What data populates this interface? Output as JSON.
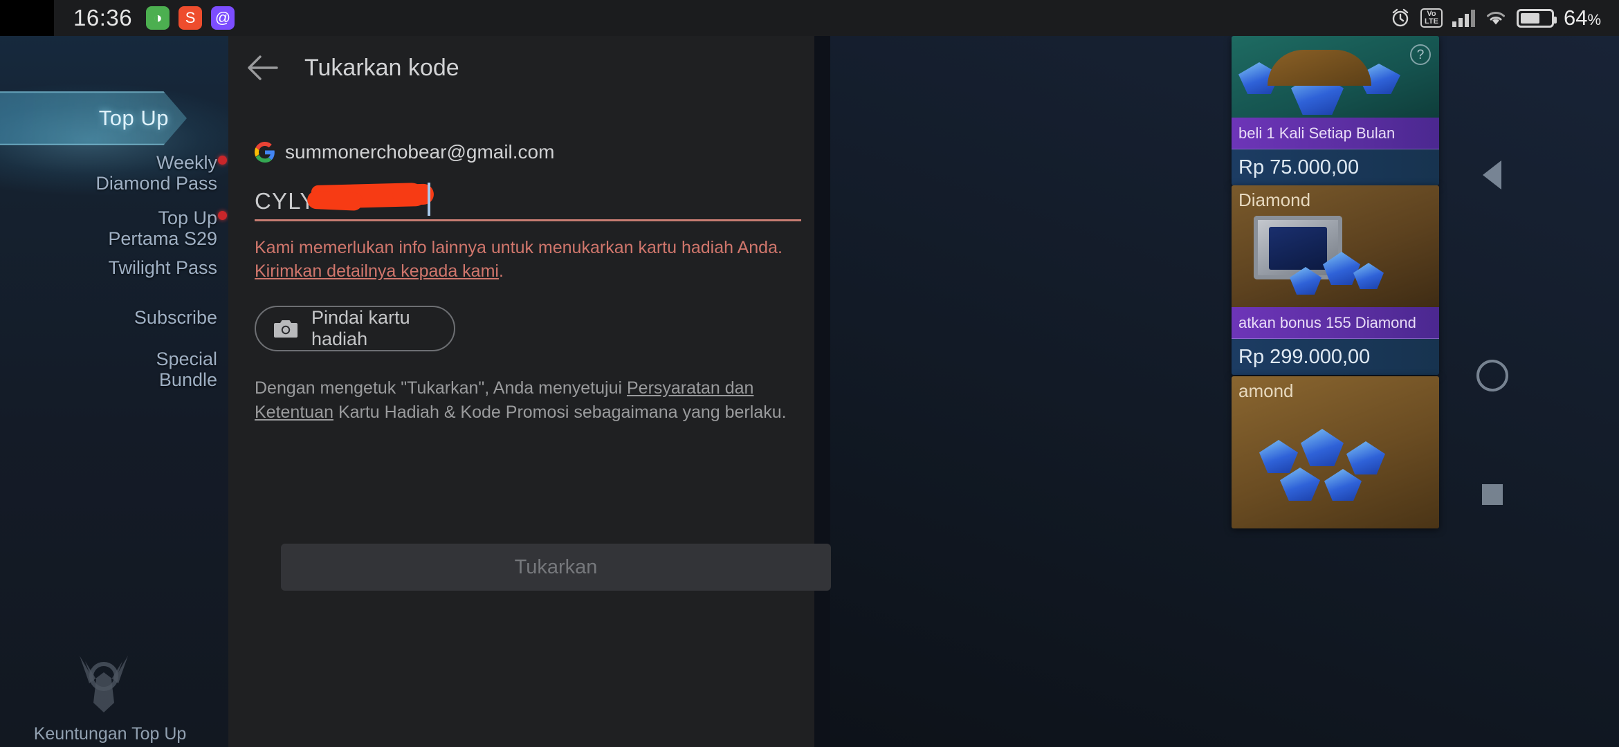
{
  "status_bar": {
    "time": "16:36",
    "notification_icons": [
      {
        "name": "green-cat-app-icon",
        "glyph": "◑",
        "color": "#4caf50"
      },
      {
        "name": "shopee-app-icon",
        "glyph": "S",
        "color": "#ee4d2d"
      },
      {
        "name": "purple-at-app-icon",
        "glyph": "@",
        "color": "#7c4dff"
      }
    ],
    "alarm_icon": "alarm-clock-icon",
    "volte_label": "VoLTE",
    "volte_top": "Vo",
    "volte_bottom": "LTE",
    "signal_icon": "cellular-signal-icon",
    "wifi_icon": "wifi-icon",
    "battery_icon": "battery-icon",
    "battery_percent": "64",
    "battery_percent_symbol": "%"
  },
  "dialog": {
    "back_icon": "back-arrow-icon",
    "title": "Tukarkan kode",
    "account": {
      "provider_icon": "google-g-icon",
      "email": "summonerchobear@gmail.com"
    },
    "code_input": {
      "value": "CYLY57",
      "redacted": true,
      "caret_visible": true,
      "underline_color": "#c77c72",
      "redaction_color": "#f73b14"
    },
    "error": {
      "text_before_link": "Kami memerlukan info lainnya untuk menukarkan kartu hadiah Anda. ",
      "link_text": "Kirimkan detailnya kepada kami",
      "text_after_link": ".",
      "color": "#d0766c"
    },
    "scan_button": {
      "icon": "camera-icon",
      "label": "Pindai kartu hadiah"
    },
    "terms": {
      "text_before_link": "Dengan mengetuk \"Tukarkan\", Anda menyetujui ",
      "link_text": "Persyaratan dan Ketentuan",
      "text_after_link": " Kartu Hadiah & Kode Promosi sebagaimana yang berlaku."
    },
    "submit_button": {
      "label": "Tukarkan",
      "enabled": false
    }
  },
  "game_background": {
    "left_menu": {
      "active_tab": "Top Up",
      "items": [
        {
          "label": "Weekly\nDiamond Pass",
          "badge": true
        },
        {
          "label": "Top Up\nPertama S29",
          "badge": true
        },
        {
          "label": "Twilight Pass",
          "badge": false
        },
        {
          "label": "Subscribe",
          "badge": false
        },
        {
          "label": "Special\nBundle",
          "badge": false
        }
      ],
      "footer": {
        "icon": "winged-emblem-icon",
        "label": "Keuntungan Top Up"
      }
    },
    "offer_cards": [
      {
        "art": "diamond-pile-art",
        "ribbon": "beli 1 Kali Setiap Bulan",
        "price": "Rp 75.000,00",
        "help_icon": "help-question-icon",
        "help_glyph": "?"
      },
      {
        "art": "diamond-safe-art",
        "title_overlay": "Diamond",
        "ribbon": "atkan bonus 155 Diamond",
        "price": "Rp 299.000,00"
      },
      {
        "art": "diamond-heap-art",
        "title_overlay": "amond",
        "ribbon": "",
        "price": ""
      }
    ],
    "nav_controls": [
      {
        "name": "nav-arrow-left-icon"
      },
      {
        "name": "nav-circle-icon"
      },
      {
        "name": "nav-square-icon"
      }
    ]
  }
}
